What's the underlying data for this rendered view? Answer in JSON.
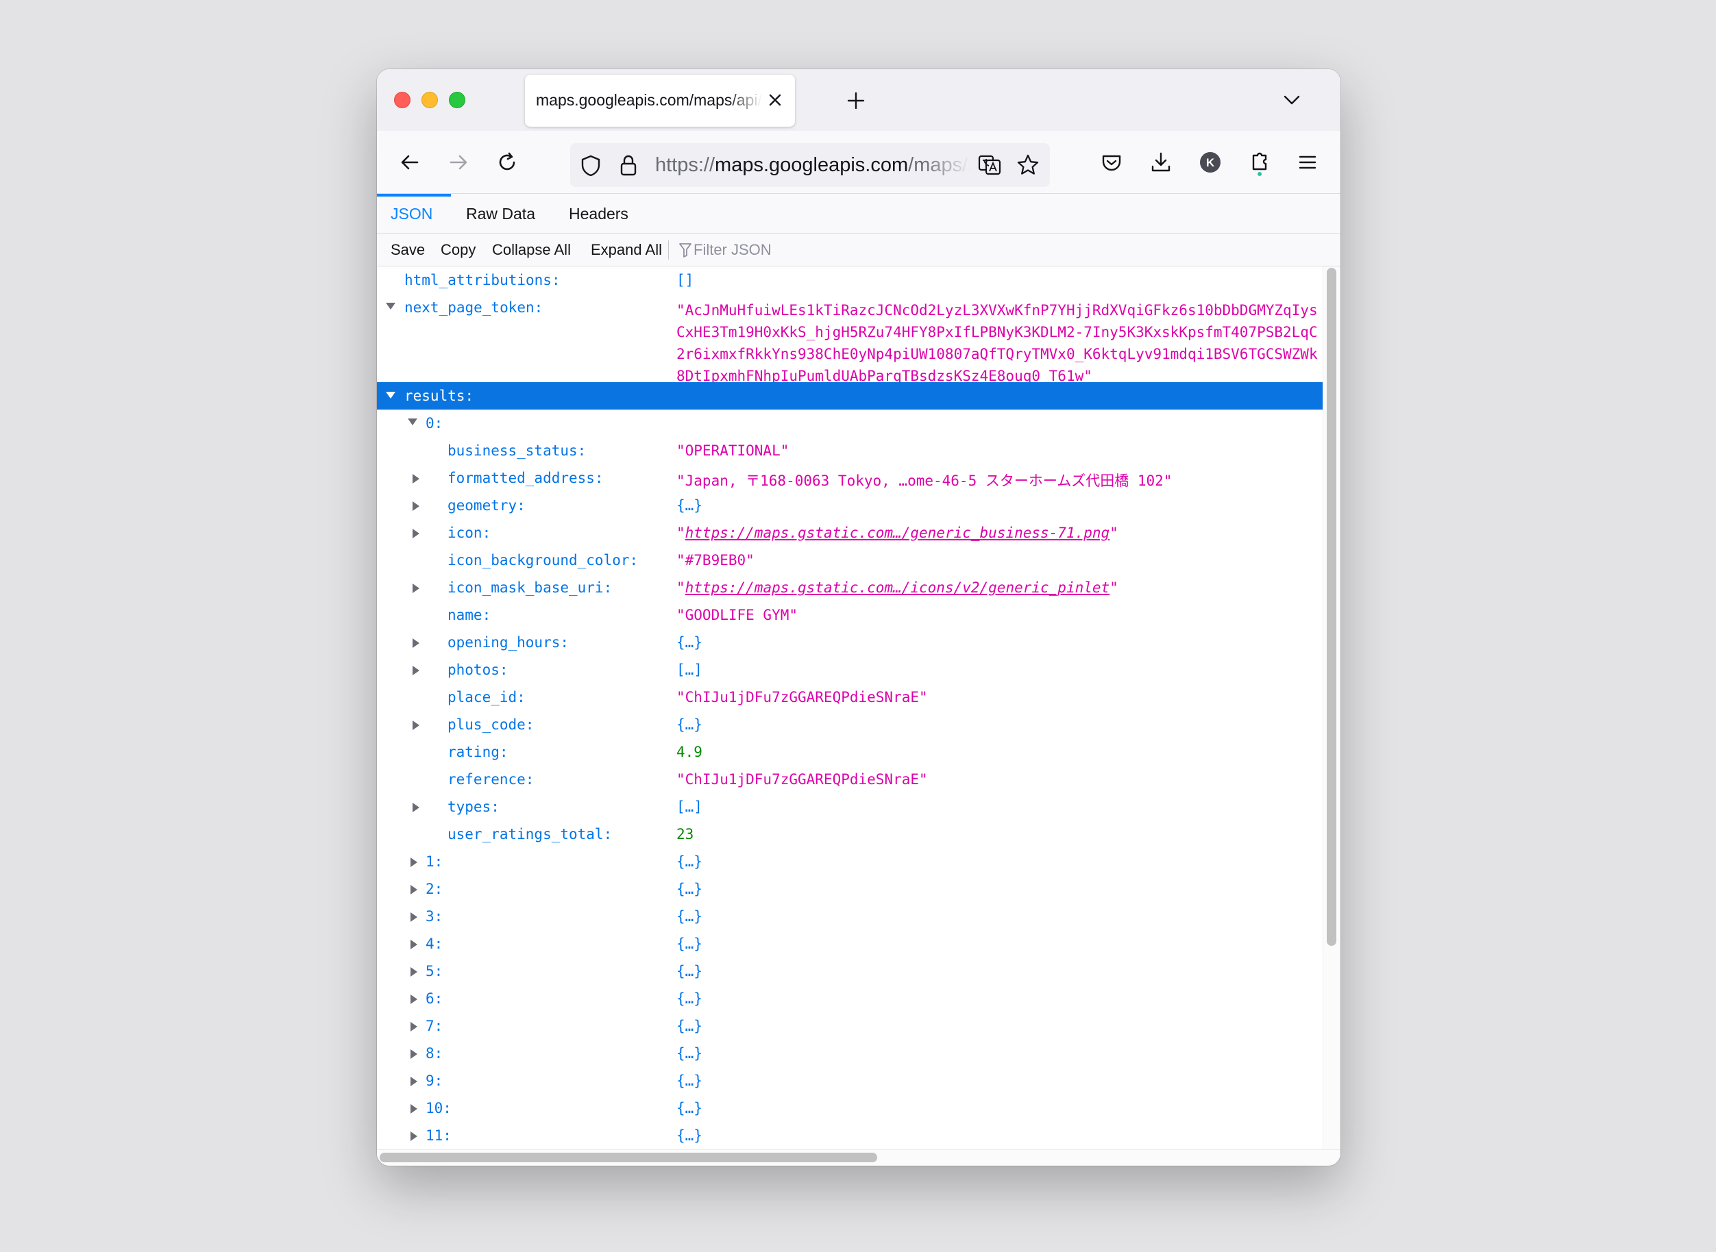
{
  "browser": {
    "tab_title": "maps.googleapis.com/maps/api/place/nearbysearch/json",
    "url_prefix": "https://",
    "url_domain": "maps.googleapis.com",
    "url_path": "/maps/api/place/nearbysearch/json",
    "profile_initial": "K"
  },
  "viewer": {
    "tabs": [
      "JSON",
      "Raw Data",
      "Headers"
    ],
    "toolbar": {
      "save": "Save",
      "copy": "Copy",
      "collapse_all": "Collapse All",
      "expand_all": "Expand All",
      "filter_placeholder": "Filter JSON"
    }
  },
  "json": {
    "html_attributions": {
      "key": "html_attributions:",
      "value": "[]"
    },
    "next_page_token": {
      "key": "next_page_token:",
      "value": "\"AcJnMuHfuiwLEs1kTiRazcJCNcOd2LyzL3XVXwKfnP7YHjjRdXVqiGFkz6s10bDbDGMYZqIysCxHE3Tm19H0xKkS_hjgH5RZu74HFY8PxIfLPBNyK3KDLM2-7Iny5K3KxskKpsfmT407PSB2LqC2r6ixmxfRkkYns938ChE0yNp4piUW10807aQfTQryTMVx0_K6ktqLyv91mdqi1BSV6TGCSWZWk8DtIpxmhFNhpIuPumldUAbParqTBsdzsKSz4E8ouq0_T61w\""
    },
    "results_key": "results:",
    "item0_key": "0:",
    "item0": [
      {
        "key": "business_status:",
        "value": "\"OPERATIONAL\"",
        "kind": "str",
        "expandable": false
      },
      {
        "key": "formatted_address:",
        "value": "\"Japan, 〒168-0063 Tokyo, …ome-46-5 スターホームズ代田橋 102\"",
        "kind": "str",
        "expandable": true
      },
      {
        "key": "geometry:",
        "value": "{…}",
        "kind": "obj",
        "expandable": true
      },
      {
        "key": "icon:",
        "value": "https://maps.gstatic.com…/generic_business-71.png",
        "kind": "link",
        "expandable": true
      },
      {
        "key": "icon_background_color:",
        "value": "\"#7B9EB0\"",
        "kind": "str",
        "expandable": false
      },
      {
        "key": "icon_mask_base_uri:",
        "value": "https://maps.gstatic.com…/icons/v2/generic_pinlet",
        "kind": "link",
        "expandable": true
      },
      {
        "key": "name:",
        "value": "\"GOODLIFE GYM\"",
        "kind": "str",
        "expandable": false
      },
      {
        "key": "opening_hours:",
        "value": "{…}",
        "kind": "obj",
        "expandable": true
      },
      {
        "key": "photos:",
        "value": "[…]",
        "kind": "obj",
        "expandable": true
      },
      {
        "key": "place_id:",
        "value": "\"ChIJu1jDFu7zGGAREQPdieSNraE\"",
        "kind": "str",
        "expandable": false
      },
      {
        "key": "plus_code:",
        "value": "{…}",
        "kind": "obj",
        "expandable": true
      },
      {
        "key": "rating:",
        "value": "4.9",
        "kind": "num",
        "expandable": false
      },
      {
        "key": "reference:",
        "value": "\"ChIJu1jDFu7zGGAREQPdieSNraE\"",
        "kind": "str",
        "expandable": false
      },
      {
        "key": "types:",
        "value": "[…]",
        "kind": "obj",
        "expandable": true
      },
      {
        "key": "user_ratings_total:",
        "value": "23",
        "kind": "num",
        "expandable": false
      }
    ],
    "collapsed_items": [
      {
        "key": "1:",
        "value": "{…}"
      },
      {
        "key": "2:",
        "value": "{…}"
      },
      {
        "key": "3:",
        "value": "{…}"
      },
      {
        "key": "4:",
        "value": "{…}"
      },
      {
        "key": "5:",
        "value": "{…}"
      },
      {
        "key": "6:",
        "value": "{…}"
      },
      {
        "key": "7:",
        "value": "{…}"
      },
      {
        "key": "8:",
        "value": "{…}"
      },
      {
        "key": "9:",
        "value": "{…}"
      },
      {
        "key": "10:",
        "value": "{…}"
      },
      {
        "key": "11:",
        "value": "{…}"
      }
    ]
  }
}
